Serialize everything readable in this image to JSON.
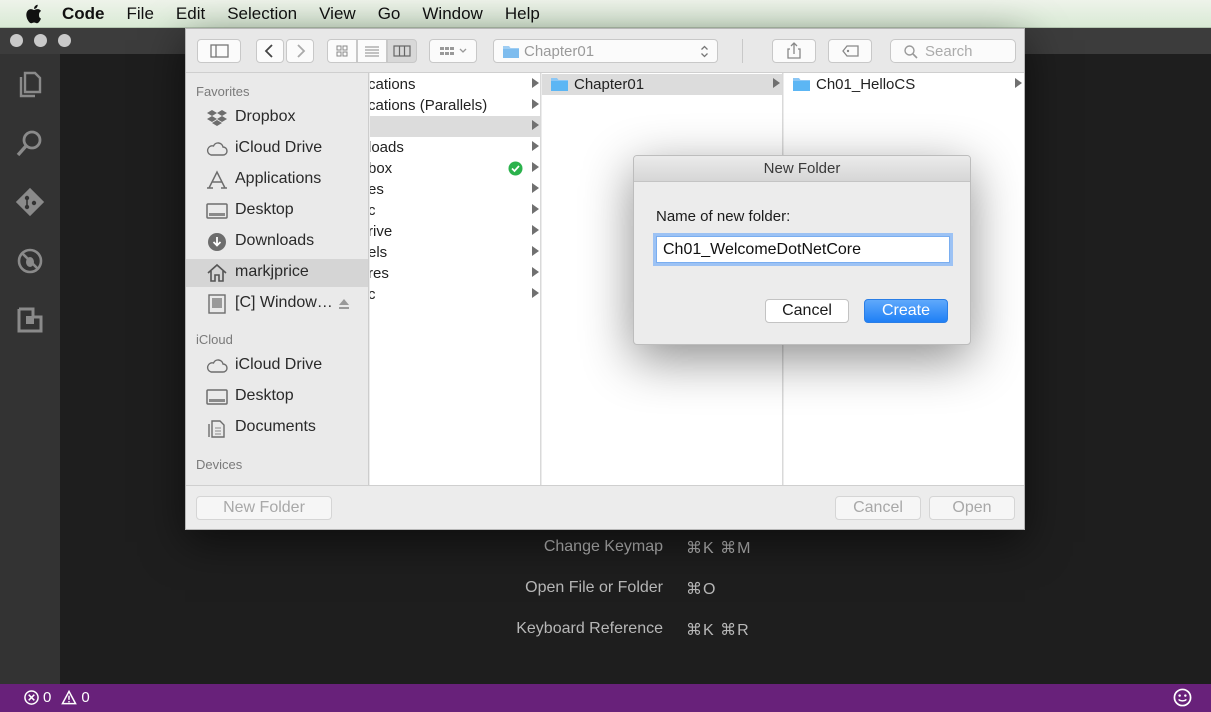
{
  "menubar": {
    "items": [
      "Code",
      "File",
      "Edit",
      "Selection",
      "View",
      "Go",
      "Window",
      "Help"
    ]
  },
  "editor": {
    "shortcuts": [
      {
        "label": "Change Keymap",
        "keys": "⌘K ⌘M"
      },
      {
        "label": "Open File or Folder",
        "keys": "⌘O"
      },
      {
        "label": "Keyboard Reference",
        "keys": "⌘K ⌘R"
      }
    ]
  },
  "statusbar": {
    "errors": "0",
    "warnings": "0"
  },
  "dialog": {
    "toolbar": {
      "path": "Chapter01",
      "search_placeholder": "Search"
    },
    "sidebar": {
      "sections": [
        {
          "heading": "Favorites",
          "items": [
            {
              "label": "Dropbox",
              "icon": "dropbox-icon"
            },
            {
              "label": "iCloud Drive",
              "icon": "cloud-icon"
            },
            {
              "label": "Applications",
              "icon": "applications-icon"
            },
            {
              "label": "Desktop",
              "icon": "desktop-icon"
            },
            {
              "label": "Downloads",
              "icon": "downloads-icon"
            },
            {
              "label": "markjprice",
              "icon": "home-icon",
              "selected": true
            },
            {
              "label": "[C] Window…",
              "icon": "drive-icon",
              "eject": true
            }
          ]
        },
        {
          "heading": "iCloud",
          "items": [
            {
              "label": "iCloud Drive",
              "icon": "cloud-icon"
            },
            {
              "label": "Desktop",
              "icon": "desktop-icon"
            },
            {
              "label": "Documents",
              "icon": "documents-icon"
            }
          ]
        },
        {
          "heading": "Devices",
          "items": []
        }
      ]
    },
    "column1": [
      {
        "label": "cations"
      },
      {
        "label": "cations (Parallels)"
      },
      {
        "label": "",
        "selected": true
      },
      {
        "label": "loads"
      },
      {
        "label": "box",
        "check": true
      },
      {
        "label": "es"
      },
      {
        "label": "c"
      },
      {
        "label": "rive"
      },
      {
        "label": "els"
      },
      {
        "label": "res"
      },
      {
        "label": "c"
      }
    ],
    "column2": [
      {
        "label": "Chapter01",
        "selected": true
      }
    ],
    "column3": [
      {
        "label": "Ch01_HelloCS"
      }
    ],
    "footer": {
      "new_folder": "New Folder",
      "cancel": "Cancel",
      "open": "Open"
    }
  },
  "new_folder_sheet": {
    "title": "New Folder",
    "label": "Name of new folder:",
    "value": "Ch01_WelcomeDotNetCore",
    "cancel": "Cancel",
    "create": "Create"
  },
  "colors": {
    "statusbar": "#68217a",
    "accent": "#1f7ff5",
    "folder": "#5cb6f4"
  }
}
